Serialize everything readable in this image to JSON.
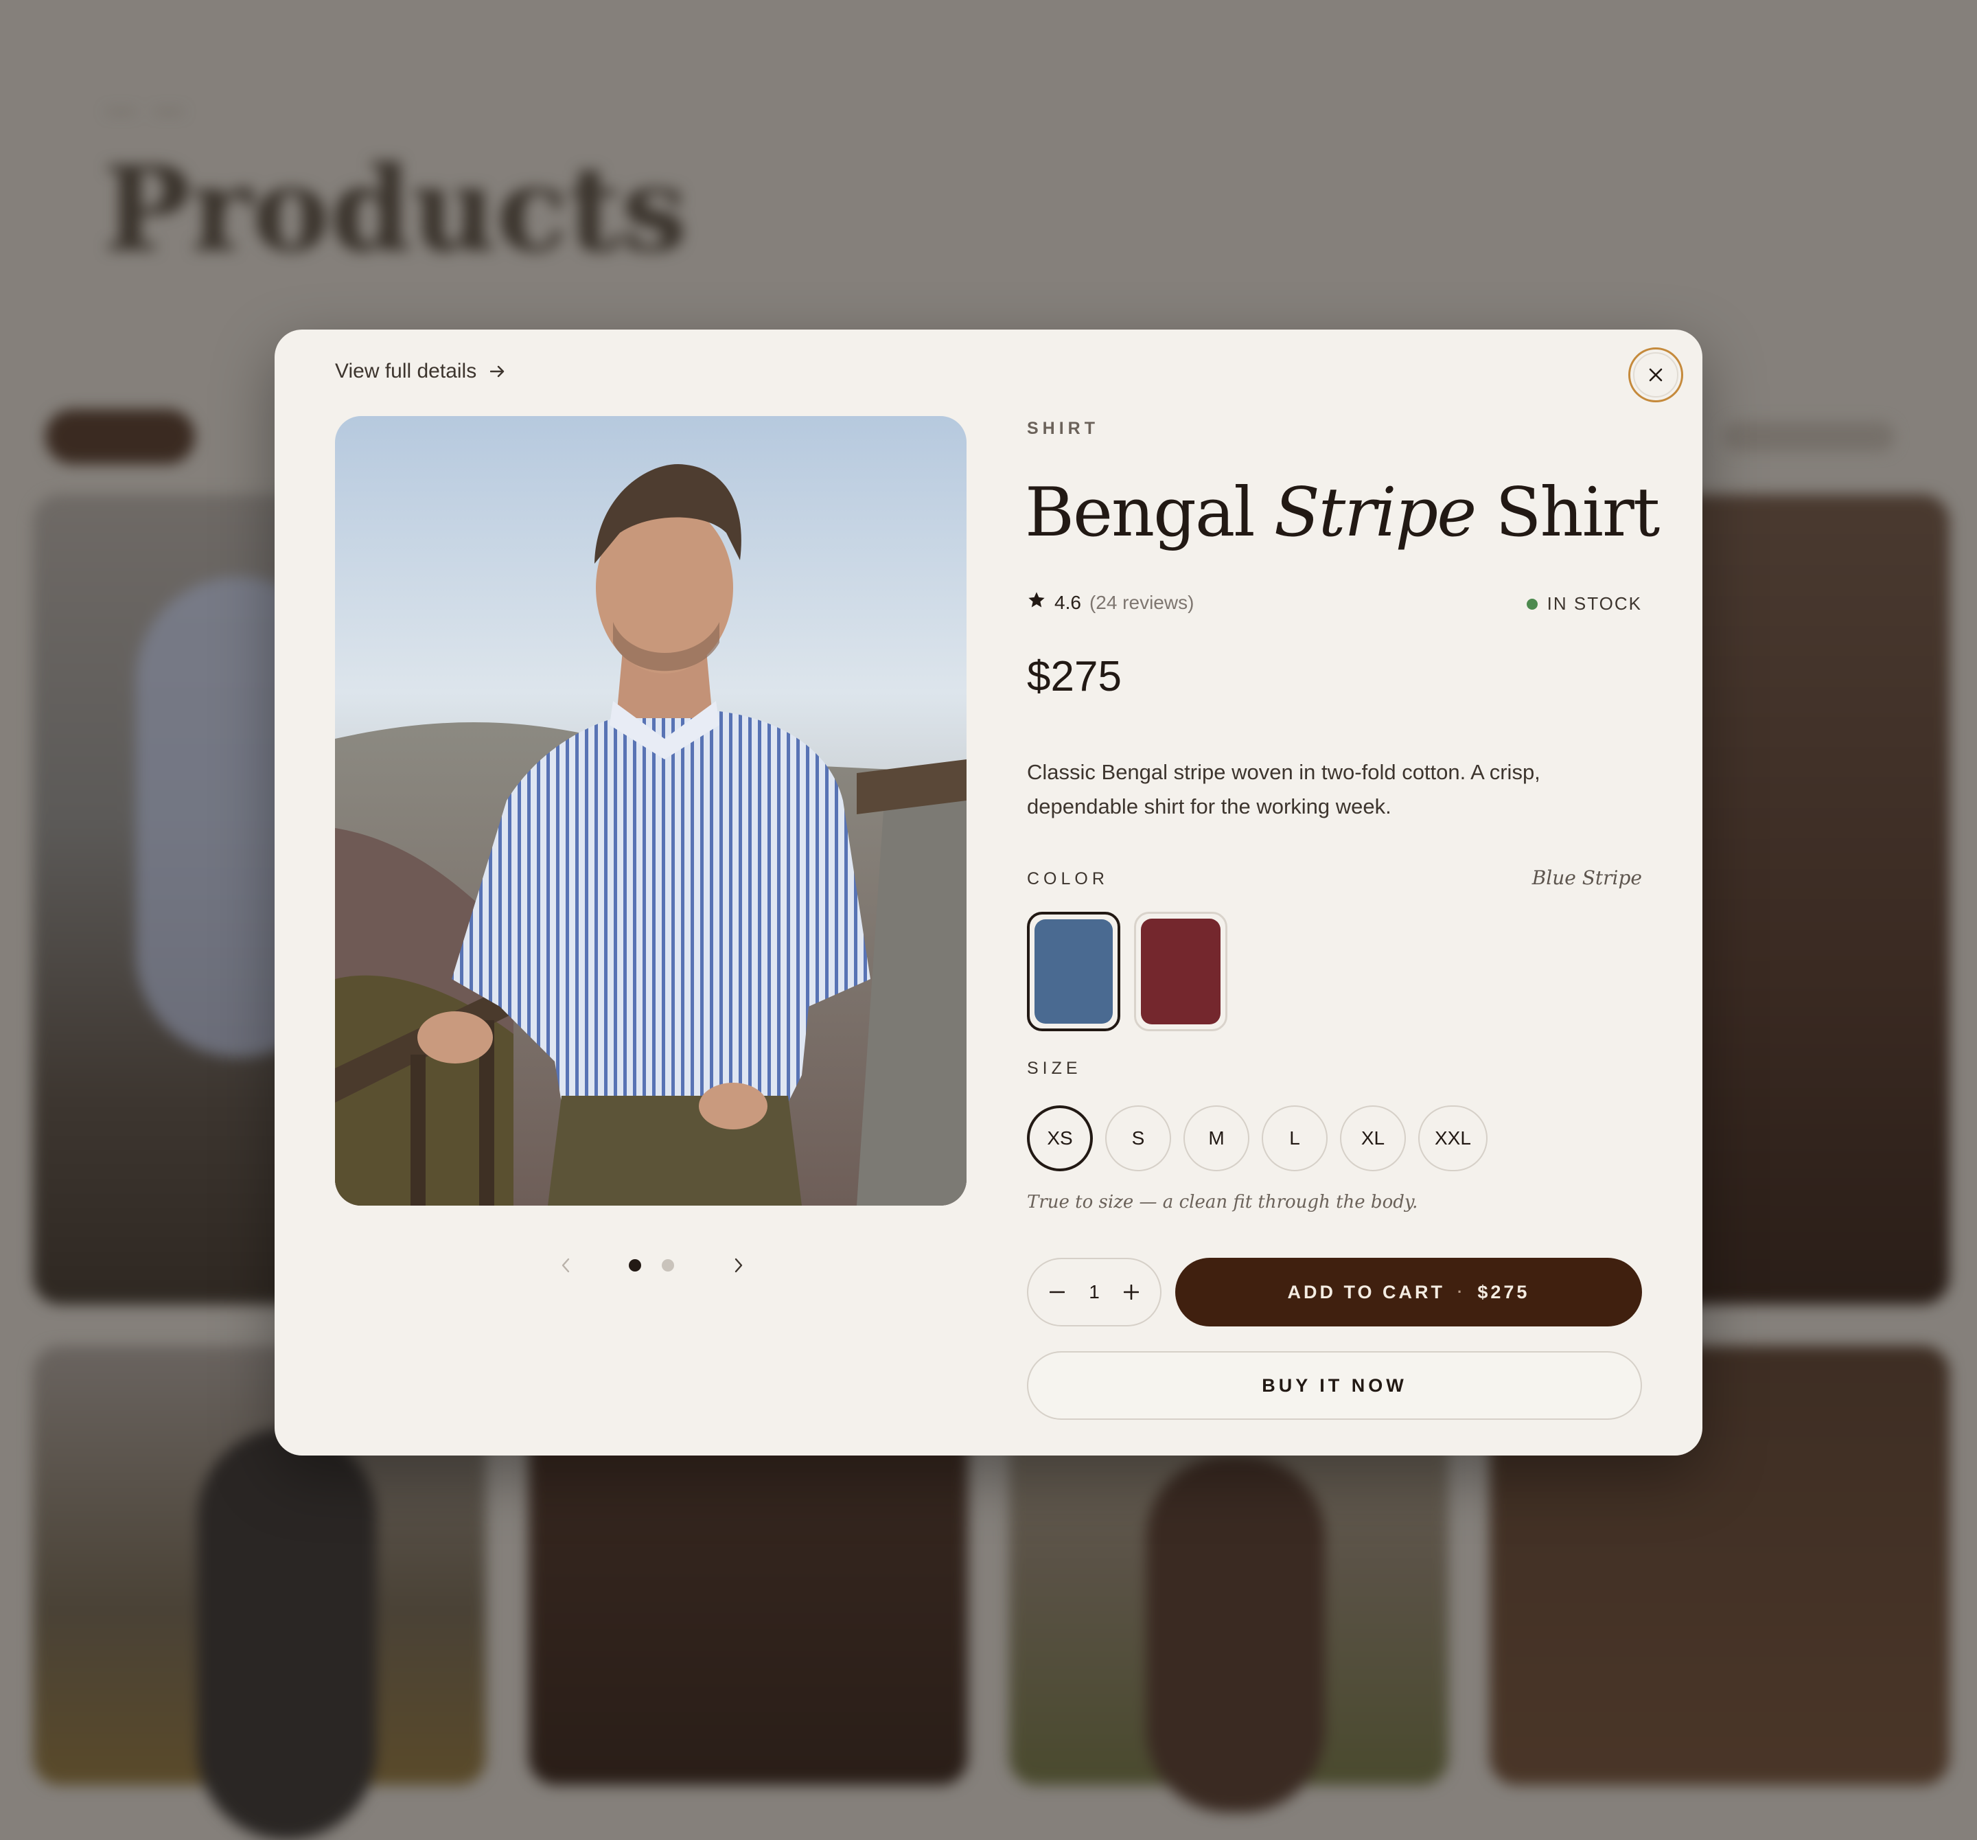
{
  "background": {
    "page_title": "Products"
  },
  "modal": {
    "view_details": "View full details",
    "product": {
      "category": "SHIRT",
      "title_part1": "Bengal",
      "title_italic": "Stripe",
      "title_part2": "Shirt",
      "rating": "4.6",
      "reviews": "(24 reviews)",
      "stock": "IN STOCK",
      "price": "$275",
      "description": "Classic Bengal stripe woven in two-fold cotton. A crisp, dependable shirt for the working week."
    },
    "color": {
      "label": "COLOR",
      "selected_name": "Blue Stripe",
      "swatches": [
        {
          "name": "blue",
          "hex": "#4a6a91",
          "selected": true
        },
        {
          "name": "burgundy",
          "hex": "#74272d",
          "selected": false
        }
      ]
    },
    "size": {
      "label": "SIZE",
      "options": [
        "XS",
        "S",
        "M",
        "L",
        "XL",
        "XXL"
      ],
      "selected": "XS",
      "fit_note": "True to size — a clean fit through the body."
    },
    "carousel": {
      "total_images": 2,
      "active_index": 1
    },
    "quantity": "1",
    "add_to_cart": "ADD TO CART",
    "add_to_cart_sep": "·",
    "add_to_cart_price": "$275",
    "buy_now": "BUY IT NOW"
  },
  "colors": {
    "modal_bg": "#f4f1ec",
    "primary_button": "#40200f",
    "text": "#221914",
    "stock_green": "#4d8a4f",
    "focus_ring": "#c58a3c"
  }
}
